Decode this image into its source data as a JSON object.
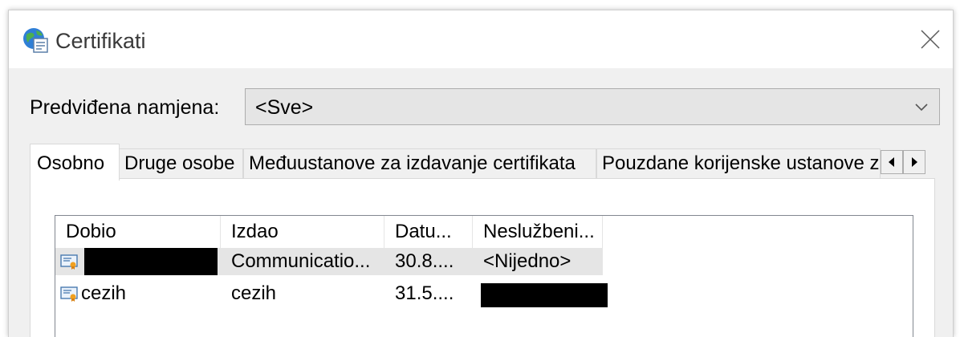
{
  "window": {
    "title": "Certifikati",
    "close_glyph": "×"
  },
  "purpose": {
    "label": "Predviđena namjena:",
    "selected": "<Sve>"
  },
  "tabs": [
    {
      "label": "Osobno",
      "active": true
    },
    {
      "label": "Druge osobe",
      "active": false
    },
    {
      "label": "Međuustanove za izdavanje certifikata",
      "active": false
    },
    {
      "label": "Pouzdane korijenske ustanove za izdavanje certifikata",
      "active": false
    }
  ],
  "table": {
    "columns": [
      "Dobio",
      "Izdao",
      "Datu...",
      "Neslužbeni..."
    ],
    "rows": [
      {
        "dobio": "",
        "izdao": "Communicatio...",
        "datum": "30.8....",
        "neluzbeni": "<Nijedno>",
        "selected": true,
        "dobio_redacted": true,
        "nesl_redacted": false
      },
      {
        "dobio": "cezih",
        "izdao": "cezih",
        "datum": "31.5....",
        "neluzbeni": "",
        "selected": false,
        "dobio_redacted": false,
        "nesl_redacted": true
      }
    ]
  },
  "icons": {
    "title": "certificate-globe-icon",
    "close": "close-icon",
    "dropdown": "chevron-down-icon",
    "tab_left": "arrow-left-icon",
    "tab_right": "arrow-right-icon",
    "row": "certificate-icon"
  }
}
